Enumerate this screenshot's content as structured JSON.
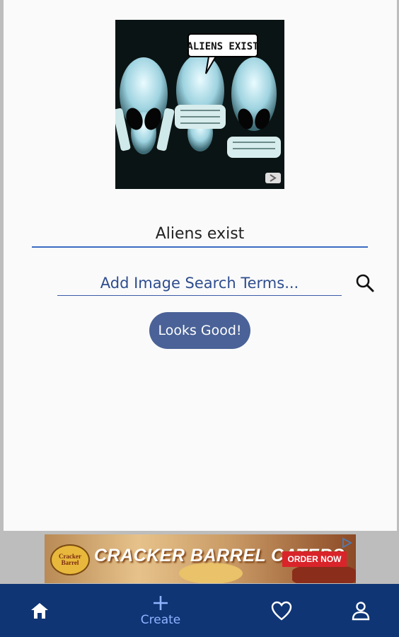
{
  "meme": {
    "speech_bubble_text": "ALIENS EXIST"
  },
  "caption": {
    "value": "Aliens exist"
  },
  "image_search": {
    "placeholder": "Add Image Search Terms...",
    "icon": "search-icon"
  },
  "actions": {
    "confirm_label": "Looks Good!"
  },
  "ad": {
    "logo_text": "Cracker Barrel",
    "headline": "CRACKER BARREL CATERS",
    "cta_label": "ORDER NOW",
    "icon": "ad-choices-icon"
  },
  "bottom_nav": {
    "items": [
      {
        "icon": "home-icon",
        "label": ""
      },
      {
        "icon": "plus-icon",
        "label": "Create"
      },
      {
        "icon": "heart-icon",
        "label": ""
      },
      {
        "icon": "person-icon",
        "label": ""
      }
    ],
    "active_color": "#8fb3ff",
    "background": "#0f3575"
  },
  "colors": {
    "accent": "#4a6297",
    "underline": "#3a6bc2"
  }
}
